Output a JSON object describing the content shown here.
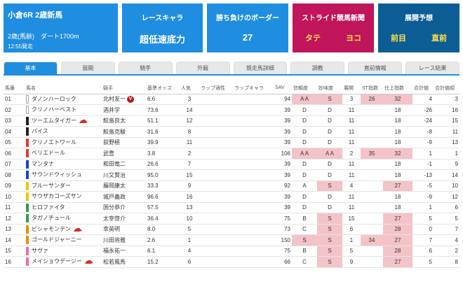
{
  "race": {
    "title": "小倉6R 2歳新馬",
    "info": "2歳(馬齢)　ダート1700m",
    "time": "12:55発走"
  },
  "cards": {
    "chara": {
      "title": "レースキャラ",
      "value": "超低速底力"
    },
    "border": {
      "title": "勝ち負けのボーダー",
      "value": "27"
    },
    "stride": {
      "title": "ストライド競馬新聞",
      "left": "タテ",
      "right": "ヨコ"
    },
    "yoso": {
      "title": "展開予想",
      "left": "前目",
      "right": "直前"
    }
  },
  "tabs": [
    "基本",
    "展開",
    "騎手",
    "外厩",
    "競走馬詳細",
    "調教",
    "直前情報",
    "レース結果"
  ],
  "columns": [
    "馬番",
    "馬名",
    "騎手",
    "基準オッズ",
    "人気",
    "ラップ適性",
    "ラップキャラ",
    "SAV",
    "信頼度",
    "妙味度",
    "展開",
    "ST指数",
    "仕上指数",
    "合計値",
    "合計値順"
  ],
  "rows": [
    {
      "no": "01",
      "name": "ダノンハーロック",
      "jockey": "北村友一",
      "odds": "6.6",
      "pop": "3",
      "sav": "94",
      "shin": "A A",
      "myo": "S",
      "ten": "3",
      "st": "26",
      "shia": "32",
      "sum": "4",
      "rank": "3",
      "color": "#ffffff",
      "cap": false,
      "v": true
    },
    {
      "no": "02",
      "name": "クリノハーベスト",
      "jockey": "酒井学",
      "odds": "73.6",
      "pop": "14",
      "sav": "39",
      "shin": "D",
      "myo": "D",
      "ten": "11",
      "st": "",
      "shia": "18",
      "sum": "-26",
      "rank": "16",
      "color": "#ffffff",
      "cap": false,
      "v": false
    },
    {
      "no": "03",
      "name": "ツーエムタイガー",
      "jockey": "鮫島良太",
      "odds": "51.1",
      "pop": "12",
      "sav": "39",
      "shin": "D",
      "myo": "D",
      "ten": "11",
      "st": "",
      "shia": "18",
      "sum": "-24",
      "rank": "15",
      "color": "#222222",
      "cap": true,
      "v": false
    },
    {
      "no": "04",
      "name": "パイス",
      "jockey": "鮫島克駿",
      "odds": "31.6",
      "pop": "8",
      "sav": "39",
      "shin": "D",
      "myo": "D",
      "ten": "11",
      "st": "",
      "shia": "18",
      "sum": "-8",
      "rank": "11",
      "color": "#222222",
      "cap": false,
      "v": false
    },
    {
      "no": "05",
      "name": "クリノエトワール",
      "jockey": "荻野極",
      "odds": "39.9",
      "pop": "11",
      "sav": "39",
      "shin": "D",
      "myo": "D",
      "ten": "11",
      "st": "",
      "shia": "18",
      "sum": "-9",
      "rank": "13",
      "color": "#e53935",
      "cap": false,
      "v": false
    },
    {
      "no": "06",
      "name": "ベリエドール",
      "jockey": "武豊",
      "odds": "3.8",
      "pop": "2",
      "sav": "106",
      "shin": "A A",
      "myo": "A A",
      "ten": "2",
      "st": "35",
      "shia": "32",
      "sum": "1",
      "rank": "1",
      "color": "#e53935",
      "cap": false,
      "v": false
    },
    {
      "no": "07",
      "name": "マンタナ",
      "jockey": "和田竜二",
      "odds": "26.6",
      "pop": "7",
      "sav": "39",
      "shin": "D",
      "myo": "D",
      "ten": "11",
      "st": "",
      "shia": "18",
      "sum": "-1",
      "rank": "9",
      "color": "#1e40d0",
      "cap": false,
      "v": false
    },
    {
      "no": "08",
      "name": "サウンドウィッシュ",
      "jockey": "川又賢治",
      "odds": "95.0",
      "pop": "15",
      "sav": "39",
      "shin": "D",
      "myo": "D",
      "ten": "11",
      "st": "",
      "shia": "18",
      "sum": "-13",
      "rank": "14",
      "color": "#1e40d0",
      "cap": false,
      "v": false
    },
    {
      "no": "09",
      "name": "ブルーサンダー",
      "jockey": "藤岡康太",
      "odds": "33.3",
      "pop": "9",
      "sav": "92",
      "shin": "A",
      "myo": "S",
      "ten": "4",
      "st": "",
      "shia": "27",
      "sum": "-5",
      "rank": "10",
      "color": "#f5c400",
      "cap": false,
      "v": false
    },
    {
      "no": "10",
      "name": "サウザカコーズサン",
      "jockey": "城戸義政",
      "odds": "96.6",
      "pop": "16",
      "sav": "39",
      "shin": "D",
      "myo": "D",
      "ten": "11",
      "st": "",
      "shia": "18",
      "sum": "-9",
      "rank": "12",
      "color": "#f5c400",
      "cap": false,
      "v": false
    },
    {
      "no": "11",
      "name": "ヒロファイタ",
      "jockey": "国分恭介",
      "odds": "57.5",
      "pop": "13",
      "sav": "39",
      "shin": "D",
      "myo": "D",
      "ten": "11",
      "st": "",
      "shia": "18",
      "sum": "1",
      "rank": "6",
      "color": "#2e9e4f",
      "cap": false,
      "v": false
    },
    {
      "no": "12",
      "name": "タガノチュール",
      "jockey": "太宰啓介",
      "odds": "36.4",
      "pop": "10",
      "sav": "75",
      "shin": "B",
      "myo": "S",
      "ten": "15",
      "st": "",
      "shia": "27",
      "sum": "5",
      "rank": "5",
      "color": "#2e9e4f",
      "cap": false,
      "v": false
    },
    {
      "no": "13",
      "name": "ビシャモンテン",
      "jockey": "幸英明",
      "odds": "8.0",
      "pop": "5",
      "sav": "73",
      "shin": "C",
      "myo": "S",
      "ten": "6",
      "st": "",
      "shia": "28",
      "sum": "0",
      "rank": "7",
      "color": "#f08c00",
      "cap": true,
      "v": false
    },
    {
      "no": "14",
      "name": "ゴールドジャーニー",
      "jockey": "川田将雅",
      "odds": "2.6",
      "pop": "1",
      "sav": "150",
      "shin": "S",
      "myo": "S",
      "ten": "1",
      "st": "34",
      "shia": "27",
      "sum": "7",
      "rank": "4",
      "color": "#f08c00",
      "cap": false,
      "v": false
    },
    {
      "no": "15",
      "name": "サヴァ",
      "jockey": "福永祐一",
      "odds": "6.1",
      "pop": "4",
      "sav": "75",
      "shin": "B",
      "myo": "S",
      "ten": "5",
      "st": "",
      "shia": "28",
      "sum": "6",
      "rank": "2",
      "color": "#ec6fa8",
      "cap": false,
      "v": false
    },
    {
      "no": "16",
      "name": "メイショウデージー",
      "jockey": "松若風馬",
      "odds": "15.2",
      "pop": "6",
      "sav": "66",
      "shin": "C",
      "myo": "S",
      "ten": "9",
      "st": "",
      "shia": "27",
      "sum": "5",
      "rank": "8",
      "color": "#ec6fa8",
      "cap": true,
      "v": false
    }
  ]
}
